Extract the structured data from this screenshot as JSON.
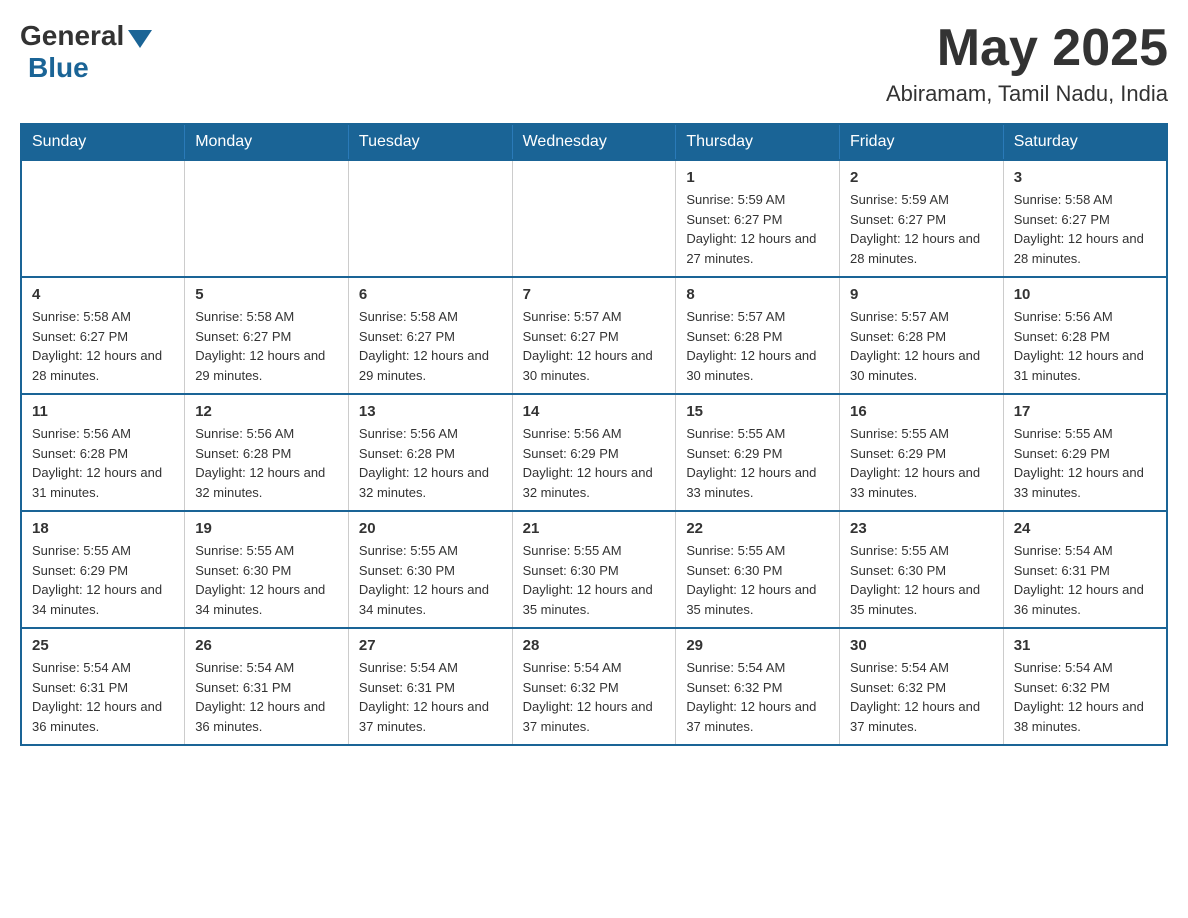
{
  "header": {
    "logo_general": "General",
    "logo_blue": "Blue",
    "month_title": "May 2025",
    "location": "Abiramam, Tamil Nadu, India"
  },
  "days_of_week": [
    "Sunday",
    "Monday",
    "Tuesday",
    "Wednesday",
    "Thursday",
    "Friday",
    "Saturday"
  ],
  "weeks": [
    [
      {
        "day": "",
        "info": ""
      },
      {
        "day": "",
        "info": ""
      },
      {
        "day": "",
        "info": ""
      },
      {
        "day": "",
        "info": ""
      },
      {
        "day": "1",
        "info": "Sunrise: 5:59 AM\nSunset: 6:27 PM\nDaylight: 12 hours and 27 minutes."
      },
      {
        "day": "2",
        "info": "Sunrise: 5:59 AM\nSunset: 6:27 PM\nDaylight: 12 hours and 28 minutes."
      },
      {
        "day": "3",
        "info": "Sunrise: 5:58 AM\nSunset: 6:27 PM\nDaylight: 12 hours and 28 minutes."
      }
    ],
    [
      {
        "day": "4",
        "info": "Sunrise: 5:58 AM\nSunset: 6:27 PM\nDaylight: 12 hours and 28 minutes."
      },
      {
        "day": "5",
        "info": "Sunrise: 5:58 AM\nSunset: 6:27 PM\nDaylight: 12 hours and 29 minutes."
      },
      {
        "day": "6",
        "info": "Sunrise: 5:58 AM\nSunset: 6:27 PM\nDaylight: 12 hours and 29 minutes."
      },
      {
        "day": "7",
        "info": "Sunrise: 5:57 AM\nSunset: 6:27 PM\nDaylight: 12 hours and 30 minutes."
      },
      {
        "day": "8",
        "info": "Sunrise: 5:57 AM\nSunset: 6:28 PM\nDaylight: 12 hours and 30 minutes."
      },
      {
        "day": "9",
        "info": "Sunrise: 5:57 AM\nSunset: 6:28 PM\nDaylight: 12 hours and 30 minutes."
      },
      {
        "day": "10",
        "info": "Sunrise: 5:56 AM\nSunset: 6:28 PM\nDaylight: 12 hours and 31 minutes."
      }
    ],
    [
      {
        "day": "11",
        "info": "Sunrise: 5:56 AM\nSunset: 6:28 PM\nDaylight: 12 hours and 31 minutes."
      },
      {
        "day": "12",
        "info": "Sunrise: 5:56 AM\nSunset: 6:28 PM\nDaylight: 12 hours and 32 minutes."
      },
      {
        "day": "13",
        "info": "Sunrise: 5:56 AM\nSunset: 6:28 PM\nDaylight: 12 hours and 32 minutes."
      },
      {
        "day": "14",
        "info": "Sunrise: 5:56 AM\nSunset: 6:29 PM\nDaylight: 12 hours and 32 minutes."
      },
      {
        "day": "15",
        "info": "Sunrise: 5:55 AM\nSunset: 6:29 PM\nDaylight: 12 hours and 33 minutes."
      },
      {
        "day": "16",
        "info": "Sunrise: 5:55 AM\nSunset: 6:29 PM\nDaylight: 12 hours and 33 minutes."
      },
      {
        "day": "17",
        "info": "Sunrise: 5:55 AM\nSunset: 6:29 PM\nDaylight: 12 hours and 33 minutes."
      }
    ],
    [
      {
        "day": "18",
        "info": "Sunrise: 5:55 AM\nSunset: 6:29 PM\nDaylight: 12 hours and 34 minutes."
      },
      {
        "day": "19",
        "info": "Sunrise: 5:55 AM\nSunset: 6:30 PM\nDaylight: 12 hours and 34 minutes."
      },
      {
        "day": "20",
        "info": "Sunrise: 5:55 AM\nSunset: 6:30 PM\nDaylight: 12 hours and 34 minutes."
      },
      {
        "day": "21",
        "info": "Sunrise: 5:55 AM\nSunset: 6:30 PM\nDaylight: 12 hours and 35 minutes."
      },
      {
        "day": "22",
        "info": "Sunrise: 5:55 AM\nSunset: 6:30 PM\nDaylight: 12 hours and 35 minutes."
      },
      {
        "day": "23",
        "info": "Sunrise: 5:55 AM\nSunset: 6:30 PM\nDaylight: 12 hours and 35 minutes."
      },
      {
        "day": "24",
        "info": "Sunrise: 5:54 AM\nSunset: 6:31 PM\nDaylight: 12 hours and 36 minutes."
      }
    ],
    [
      {
        "day": "25",
        "info": "Sunrise: 5:54 AM\nSunset: 6:31 PM\nDaylight: 12 hours and 36 minutes."
      },
      {
        "day": "26",
        "info": "Sunrise: 5:54 AM\nSunset: 6:31 PM\nDaylight: 12 hours and 36 minutes."
      },
      {
        "day": "27",
        "info": "Sunrise: 5:54 AM\nSunset: 6:31 PM\nDaylight: 12 hours and 37 minutes."
      },
      {
        "day": "28",
        "info": "Sunrise: 5:54 AM\nSunset: 6:32 PM\nDaylight: 12 hours and 37 minutes."
      },
      {
        "day": "29",
        "info": "Sunrise: 5:54 AM\nSunset: 6:32 PM\nDaylight: 12 hours and 37 minutes."
      },
      {
        "day": "30",
        "info": "Sunrise: 5:54 AM\nSunset: 6:32 PM\nDaylight: 12 hours and 37 minutes."
      },
      {
        "day": "31",
        "info": "Sunrise: 5:54 AM\nSunset: 6:32 PM\nDaylight: 12 hours and 38 minutes."
      }
    ]
  ]
}
